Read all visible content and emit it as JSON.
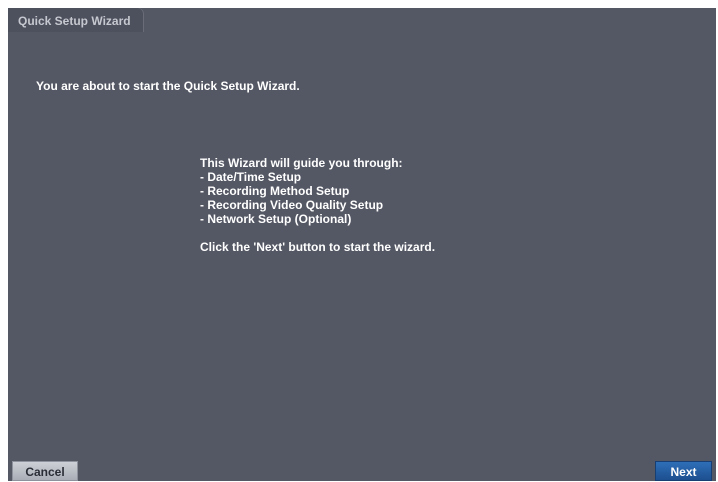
{
  "window": {
    "title": "Quick Setup Wizard"
  },
  "content": {
    "intro": "You are about to start the Quick Setup Wizard.",
    "guide_heading": "This Wizard will guide you through:",
    "steps": [
      "- Date/Time Setup",
      "- Recording Method Setup",
      "- Recording Video Quality Setup",
      "- Network Setup (Optional)"
    ],
    "instruction": "Click the 'Next' button to start the wizard."
  },
  "buttons": {
    "cancel_label": "Cancel",
    "next_label": "Next"
  },
  "colors": {
    "background": "#545764",
    "next_button": "#1d4f8f",
    "cancel_button": "#b8bcc4"
  }
}
